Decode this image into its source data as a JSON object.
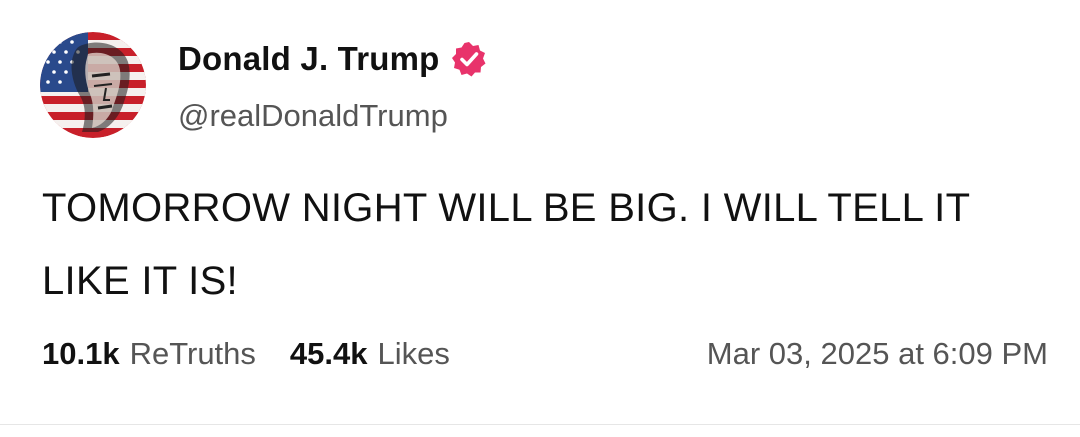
{
  "author": {
    "display_name": "Donald J. Trump",
    "handle": "@realDonaldTrump",
    "avatar_icon": "flag-portrait-avatar",
    "verified_icon": "verified-badge-icon",
    "verified_color": "#e8336b"
  },
  "post": {
    "text": "TOMORROW NIGHT WILL BE BIG. I WILL TELL IT LIKE IT IS!"
  },
  "stats": {
    "retruths_count": "10.1k",
    "retruths_label": "ReTruths",
    "likes_count": "45.4k",
    "likes_label": "Likes",
    "timestamp": "Mar 03, 2025 at 6:09 PM"
  }
}
